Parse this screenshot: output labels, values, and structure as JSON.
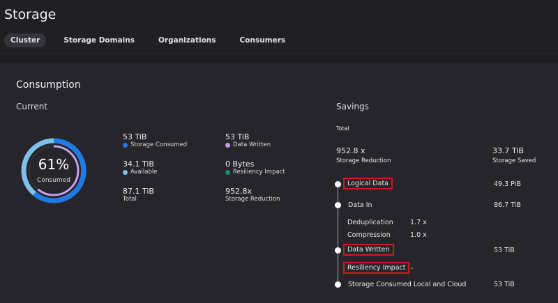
{
  "header": {
    "title": "Storage",
    "tabs": [
      {
        "label": "Cluster",
        "active": true
      },
      {
        "label": "Storage Domains"
      },
      {
        "label": "Organizations"
      },
      {
        "label": "Consumers"
      }
    ]
  },
  "consumption": {
    "title": "Consumption",
    "current": {
      "title": "Current",
      "percent": "61%",
      "percent_value": 61,
      "percent_label": "Consumed",
      "stats": [
        {
          "value": "53 TiB",
          "label": "Storage Consumed",
          "color": "#1e7be6"
        },
        {
          "value": "53 TiB",
          "label": "Data Written",
          "color": "#c39be8"
        },
        {
          "value": "34.1 TiB",
          "label": "Available",
          "color": "#7ec0ea"
        },
        {
          "value": "0 Bytes",
          "label": "Resiliency Impact",
          "color": "#1a8f6e"
        },
        {
          "value": "87.1 TiB",
          "label": "Total"
        },
        {
          "value": "952.8x",
          "label": "Storage Reduction"
        }
      ]
    },
    "savings": {
      "title": "Savings",
      "total_label": "Total",
      "reduction_value": "952.8 x",
      "reduction_label": "Storage Reduction",
      "saved_value": "33.7 TiB",
      "saved_label": "Storage Saved",
      "flow": {
        "logical": {
          "label": "Logical Data",
          "value": "49.3 PiB"
        },
        "data_in": {
          "label": "Data In",
          "value": "86.7 TiB"
        },
        "dedup": {
          "label": "Deduplication",
          "value": "1.7 x"
        },
        "compression": {
          "label": "Compression",
          "value": "1.0 x"
        },
        "written": {
          "label": "Data Written",
          "value": "53 TiB"
        },
        "resiliency": {
          "label": "Resiliency Impact",
          "value": "-"
        },
        "consumed": {
          "label": "Storage Consumed Local and Cloud",
          "value": "53 TiB"
        }
      }
    }
  }
}
